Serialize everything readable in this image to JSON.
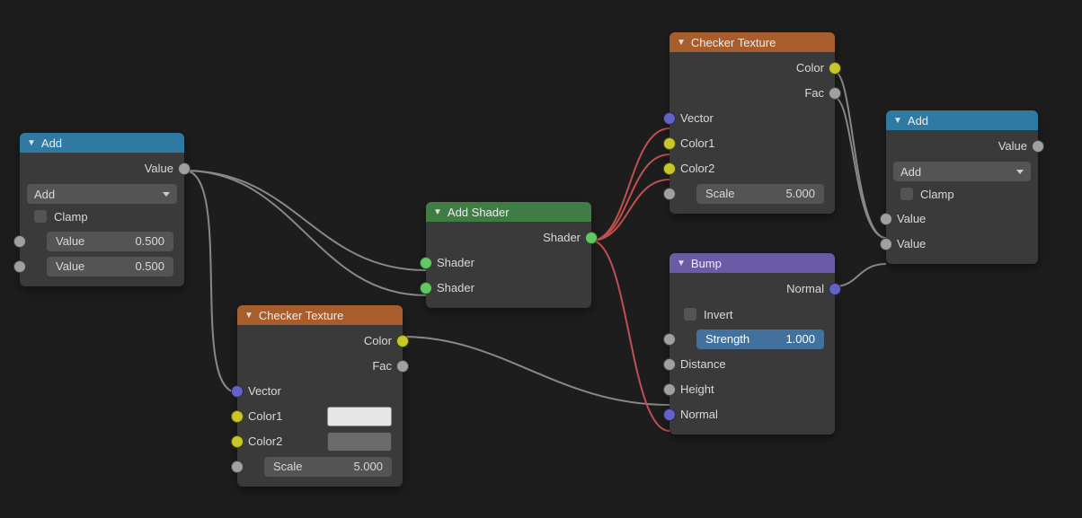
{
  "colors": {
    "header_blue": "#2f7aa3",
    "header_orange": "#a85d2c",
    "header_green": "#3f7d44",
    "header_purple": "#6b5aa5",
    "swatch_light": "#e6e6e6",
    "swatch_dark": "#6b6b6b"
  },
  "nodes": {
    "add1": {
      "title": "Add",
      "out_value": "Value",
      "operation": "Add",
      "clamp": "Clamp",
      "in1": {
        "label": "Value",
        "value": "0.500"
      },
      "in2": {
        "label": "Value",
        "value": "0.500"
      }
    },
    "checker1": {
      "title": "Checker Texture",
      "out_color": "Color",
      "out_fac": "Fac",
      "vector": "Vector",
      "color1": "Color1",
      "color2": "Color2",
      "scale": {
        "label": "Scale",
        "value": "5.000"
      }
    },
    "addshader": {
      "title": "Add Shader",
      "out": "Shader",
      "in1": "Shader",
      "in2": "Shader"
    },
    "checker2": {
      "title": "Checker Texture",
      "out_color": "Color",
      "out_fac": "Fac",
      "vector": "Vector",
      "color1": "Color1",
      "color2": "Color2",
      "scale": {
        "label": "Scale",
        "value": "5.000"
      }
    },
    "bump": {
      "title": "Bump",
      "out_normal": "Normal",
      "invert": "Invert",
      "strength": {
        "label": "Strength",
        "value": "1.000"
      },
      "distance": "Distance",
      "height": "Height",
      "normal": "Normal"
    },
    "add2": {
      "title": "Add",
      "out_value": "Value",
      "operation": "Add",
      "clamp": "Clamp",
      "in1": "Value",
      "in2": "Value"
    }
  },
  "links": [
    {
      "from": "add1.value",
      "to": "checker1.vector",
      "color": "grey"
    },
    {
      "from": "add1.value",
      "to": "addshader.in1",
      "color": "grey"
    },
    {
      "from": "add1.value",
      "to": "addshader.in2",
      "color": "grey"
    },
    {
      "from": "addshader.out",
      "to": "checker2.vector",
      "color": "red"
    },
    {
      "from": "addshader.out",
      "to": "checker2.color1",
      "color": "red"
    },
    {
      "from": "addshader.out",
      "to": "checker2.color2",
      "color": "red"
    },
    {
      "from": "addshader.out",
      "to": "bump.normal",
      "color": "red"
    },
    {
      "from": "checker1.color",
      "to": "bump.height",
      "color": "grey"
    },
    {
      "from": "checker2.color",
      "to": "add2.in1",
      "color": "grey"
    },
    {
      "from": "checker2.fac",
      "to": "add2.in1",
      "color": "grey"
    },
    {
      "from": "bump.normal_out",
      "to": "add2.in2",
      "color": "grey"
    }
  ]
}
